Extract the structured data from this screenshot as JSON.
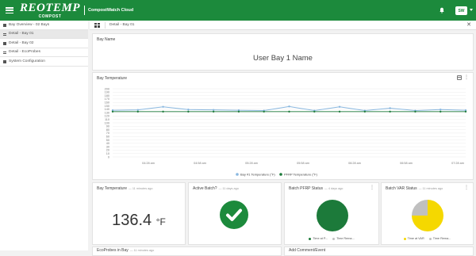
{
  "header": {
    "brand": "REOTEMP",
    "brand_sub": "COMPOST",
    "app_name": "CompostWatch Cloud",
    "user_initials": "SW"
  },
  "sidebar": {
    "items": [
      {
        "label": "Bay Overview - 02 Bays"
      },
      {
        "label": "Detail - Bay 01"
      },
      {
        "label": "Detail - Bay 02"
      },
      {
        "label": "Detail - EcoProbes"
      },
      {
        "label": "System Configuration"
      }
    ]
  },
  "breadcrumb": {
    "text": "Detail - Bay 01"
  },
  "bay_name": {
    "title": "Bay Name",
    "value": "User Bay 1 Name"
  },
  "temperature_chart": {
    "title": "Bay Temperature"
  },
  "chart_data": {
    "type": "line",
    "title": "Bay Temperature",
    "xlabel": "",
    "ylabel": "",
    "ylim": [
      0,
      200
    ],
    "yticks": [
      0,
      10,
      20,
      30,
      40,
      50,
      60,
      70,
      80,
      90,
      100,
      110,
      120,
      130,
      140,
      150,
      160,
      170,
      180,
      190,
      200
    ],
    "x_tick_labels": [
      "04:28 am",
      "04:58 am",
      "05:28 am",
      "05:58 am",
      "06:28 am",
      "06:58 am",
      "07:28 am"
    ],
    "x": [
      0,
      1,
      2,
      3,
      4,
      5,
      6,
      7,
      8,
      9,
      10,
      11,
      12,
      13,
      14
    ],
    "series": [
      {
        "name": "Bay #1 Temperature (°F)",
        "color": "#8ab8e0",
        "values": [
          137,
          138,
          147,
          139,
          138,
          137,
          136,
          148,
          136,
          147,
          136,
          143,
          136,
          139,
          137
        ]
      },
      {
        "name": "PFRP Temperature (°F)",
        "color": "#1c7a3a",
        "values": [
          133,
          133,
          133,
          133,
          133,
          133,
          133,
          133,
          133,
          133,
          133,
          133,
          133,
          133,
          133
        ]
      }
    ],
    "grid": true,
    "legend": "bottom"
  },
  "bay_temp_card": {
    "title": "Bay Temperature",
    "updated": "— 11 minutes ago",
    "value": "136.4",
    "unit": "°F"
  },
  "active_batch_card": {
    "title": "Active Batch?",
    "updated": "— 11 days ago"
  },
  "pfrp_card": {
    "title": "Batch PFRP Status",
    "updated": "— 4 days ago",
    "legend": [
      {
        "label": "Time at P...",
        "color": "#1c7a3a"
      },
      {
        "label": "Time Rema...",
        "color": "#c0c0c0"
      }
    ],
    "values": {
      "time_at": 100,
      "time_remaining": 0
    }
  },
  "var_card": {
    "title": "Batch VAR Status",
    "updated": "— 11 minutes ago",
    "legend": [
      {
        "label": "Time at VAR",
        "color": "#f5d800"
      },
      {
        "label": "Time Rema...",
        "color": "#c0c0c0"
      }
    ],
    "values": {
      "time_at": 75,
      "time_remaining": 25
    }
  },
  "bottom_cards": [
    {
      "title": "EcoProbes in Bay",
      "updated": "— 11 minutes ago"
    },
    {
      "title": "Add Comment/Event"
    }
  ]
}
